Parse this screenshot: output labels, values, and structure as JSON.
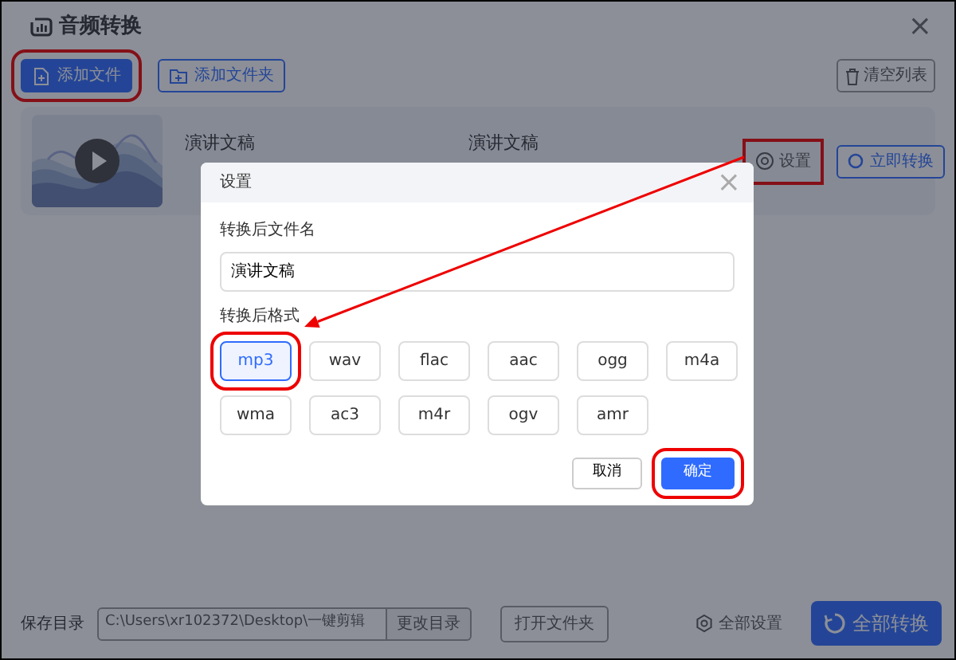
{
  "window": {
    "title": "音频转换",
    "close": "×"
  },
  "toolbar": {
    "buttons": [
      {
        "label": "添加文件",
        "kind": "primary",
        "highlighted": true
      },
      {
        "label": "添加文件夹",
        "kind": "outline",
        "highlighted": false
      }
    ],
    "clear_button": "清空列表"
  },
  "files": [
    {
      "name": "演讲文稿",
      "output_name": "演讲文稿",
      "settings_button": {
        "label": "设置",
        "highlighted": true
      },
      "convert_button": "立即转换"
    }
  ],
  "footer": {
    "label": "保存目录",
    "path": "C:\\Users\\xr102372\\Desktop\\一键剪辑",
    "change_button": "更改目录",
    "open_button": "打开文件夹",
    "settings_link": "全部设置",
    "convert_all_button": "全部转换"
  },
  "dialog": {
    "title": "设置",
    "close": "×",
    "filename_label": "转换后文件名",
    "filename_value": "演讲文稿",
    "format_label": "转换后格式",
    "formats": [
      {
        "label": "mp3",
        "selected": true,
        "highlighted": true
      },
      {
        "label": "wav",
        "selected": false,
        "highlighted": false
      },
      {
        "label": "flac",
        "selected": false,
        "highlighted": false
      },
      {
        "label": "aac",
        "selected": false,
        "highlighted": false
      },
      {
        "label": "ogg",
        "selected": false,
        "highlighted": false
      },
      {
        "label": "m4a",
        "selected": false,
        "highlighted": false
      },
      {
        "label": "wma",
        "selected": false,
        "highlighted": false
      },
      {
        "label": "ac3",
        "selected": false,
        "highlighted": false
      },
      {
        "label": "m4r",
        "selected": false,
        "highlighted": false
      },
      {
        "label": "ogv",
        "selected": false,
        "highlighted": false
      },
      {
        "label": "amr",
        "selected": false,
        "highlighted": false
      }
    ],
    "cancel_button": "取消",
    "confirm_button": {
      "label": "确定",
      "highlighted": true
    }
  },
  "annotation_arrow": true
}
